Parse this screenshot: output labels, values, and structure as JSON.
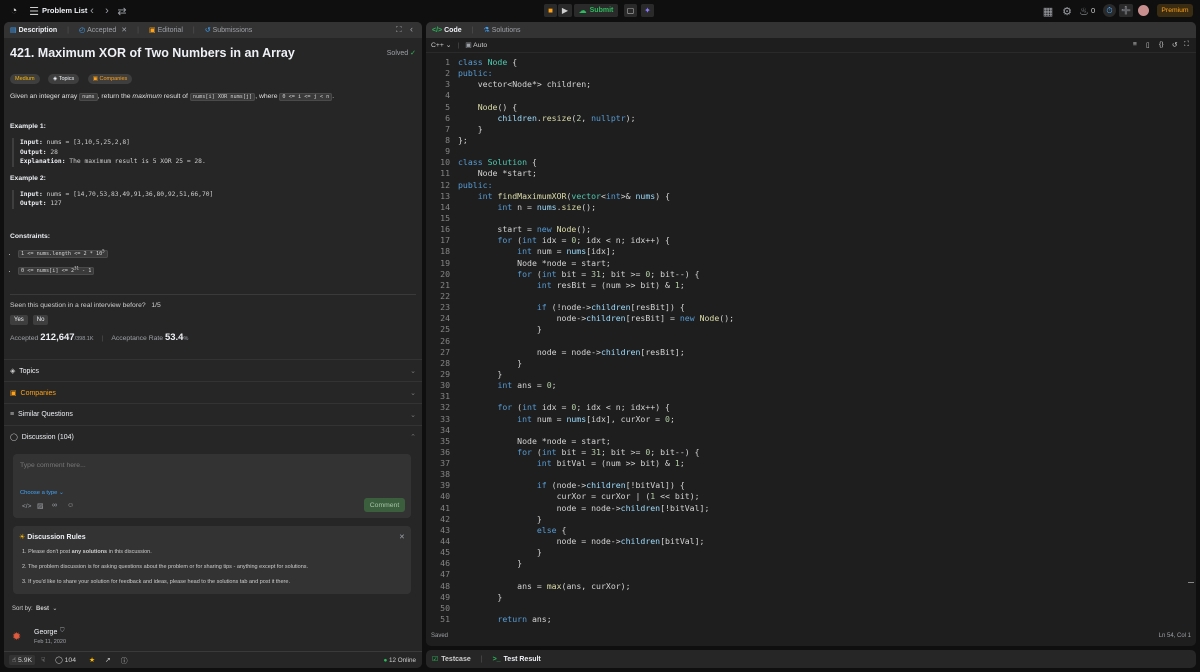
{
  "topbar": {
    "problem_list": "Problem List",
    "submit": "Submit",
    "streak": "0",
    "premium": "Premium"
  },
  "left_tabs": [
    {
      "label": "Description"
    },
    {
      "label": "Accepted"
    },
    {
      "label": "Editorial"
    },
    {
      "label": "Submissions"
    }
  ],
  "problem": {
    "title": "421. Maximum XOR of Two Numbers in an Array",
    "status": "Solved",
    "tags": [
      "Medium",
      "Topics",
      "Companies"
    ],
    "desc": [
      "Given an integer array ",
      "nums",
      ", return the ",
      "maximum",
      " result of ",
      "nums[i] XOR nums[j]",
      ", where ",
      "0 <= i <= j < n",
      "."
    ],
    "examples": [
      {
        "heading": "Example 1:",
        "lines": [
          [
            "Input:",
            " nums = [3,10,5,25,2,8]"
          ],
          [
            "Output:",
            " 28"
          ],
          [
            "Explanation:",
            " The maximum result is 5 XOR 25 = 28."
          ]
        ]
      },
      {
        "heading": "Example 2:",
        "lines": [
          [
            "Input:",
            " nums = [14,70,53,83,49,91,36,80,92,51,66,70]"
          ],
          [
            "Output:",
            " 127"
          ]
        ]
      }
    ],
    "constraints_title": "Constraints:",
    "constraints": [
      {
        "base": "1 <= nums.length <= 2 * 10",
        "sup": "5"
      },
      {
        "base": "0 <= nums[i] <= 2",
        "sup": "31",
        "tail": " - 1"
      }
    ]
  },
  "interview": {
    "question": "Seen this question in a real interview before?",
    "count": "1/5",
    "yes": "Yes",
    "no": "No"
  },
  "stats": {
    "accepted_label": "Accepted",
    "accepted_value": "212,647",
    "accepted_total": "/398.1K",
    "rate_label": "Acceptance Rate",
    "rate_value": "53.4",
    "rate_unit": "%"
  },
  "sections": [
    "Topics",
    "Companies",
    "Similar Questions",
    "Discussion (104)"
  ],
  "comment": {
    "placeholder": "Type comment here...",
    "choose": "Choose a type",
    "button": "Comment"
  },
  "rules": {
    "title": "Discussion Rules",
    "items": [
      {
        "pre": "1. Please don't post ",
        "bold": "any solutions",
        "post": " in this discussion."
      },
      {
        "pre": "2. The problem discussion is for asking questions about the problem or for sharing tips - anything except for solutions.",
        "bold": "",
        "post": ""
      },
      {
        "pre": "3. If you'd like to share your solution for feedback and ideas, please head to the solutions tab and post it there.",
        "bold": "",
        "post": ""
      }
    ]
  },
  "sort": {
    "label": "Sort by:",
    "value": "Best"
  },
  "post": {
    "user": "George",
    "date": "Feb 11, 2020"
  },
  "footer": {
    "likes": "5.9K",
    "comments": "104",
    "online": "12 Online"
  },
  "right_tabs": [
    {
      "label": "Code"
    },
    {
      "label": "Solutions"
    }
  ],
  "editor": {
    "lang": "C++",
    "mode": "Auto",
    "saved": "Saved",
    "pos": "Ln 54, Col 1"
  },
  "bottom_tabs": [
    {
      "label": "Testcase"
    },
    {
      "label": "Test Result"
    }
  ],
  "colors": {
    "accent": "#ffa116",
    "green": "#2cbb5d",
    "medium": "#ffb800",
    "link": "#3ea6ff"
  },
  "code_lines": [
    [
      [
        "class ",
        "kw"
      ],
      [
        "Node",
        "ty"
      ],
      [
        " {",
        "tx"
      ]
    ],
    [
      [
        "public:",
        "kw"
      ]
    ],
    [
      [
        "    vector<Node*> children;",
        "tx"
      ]
    ],
    [
      [
        "",
        "tx"
      ]
    ],
    [
      [
        "    ",
        "tx"
      ],
      [
        "Node",
        "fn"
      ],
      [
        "() {",
        "tx"
      ]
    ],
    [
      [
        "        ",
        "tx"
      ],
      [
        "children",
        "vr"
      ],
      [
        ".",
        "tx"
      ],
      [
        "resize",
        "fn"
      ],
      [
        "(",
        "tx"
      ],
      [
        "2",
        "nu"
      ],
      [
        ", ",
        "tx"
      ],
      [
        "nullptr",
        "kw"
      ],
      [
        ");",
        "tx"
      ]
    ],
    [
      [
        "    }",
        "tx"
      ]
    ],
    [
      [
        "};",
        "tx"
      ]
    ],
    [
      [
        "",
        "tx"
      ]
    ],
    [
      [
        "class ",
        "kw"
      ],
      [
        "Solution",
        "ty"
      ],
      [
        " {",
        "tx"
      ]
    ],
    [
      [
        "    Node *start;",
        "tx"
      ]
    ],
    [
      [
        "public:",
        "kw"
      ]
    ],
    [
      [
        "    ",
        "tx"
      ],
      [
        "int ",
        "kw"
      ],
      [
        "findMaximumXOR",
        "fn"
      ],
      [
        "(",
        "tx"
      ],
      [
        "vector",
        "ty"
      ],
      [
        "<",
        "tx"
      ],
      [
        "int",
        "kw"
      ],
      [
        ">& ",
        "tx"
      ],
      [
        "nums",
        "vr"
      ],
      [
        ") {",
        "tx"
      ]
    ],
    [
      [
        "        ",
        "tx"
      ],
      [
        "int ",
        "kw"
      ],
      [
        "n = ",
        "tx"
      ],
      [
        "nums",
        "vr"
      ],
      [
        ".",
        "tx"
      ],
      [
        "size",
        "fn"
      ],
      [
        "();",
        "tx"
      ]
    ],
    [
      [
        "",
        "tx"
      ]
    ],
    [
      [
        "        start = ",
        "tx"
      ],
      [
        "new ",
        "kw"
      ],
      [
        "Node",
        "fn"
      ],
      [
        "();",
        "tx"
      ]
    ],
    [
      [
        "        ",
        "tx"
      ],
      [
        "for ",
        "kw"
      ],
      [
        "(",
        "tx"
      ],
      [
        "int ",
        "kw"
      ],
      [
        "idx = ",
        "tx"
      ],
      [
        "0",
        "nu"
      ],
      [
        "; idx < n; idx++) {",
        "tx"
      ]
    ],
    [
      [
        "            ",
        "tx"
      ],
      [
        "int ",
        "kw"
      ],
      [
        "num = ",
        "tx"
      ],
      [
        "nums",
        "vr"
      ],
      [
        "[idx];",
        "tx"
      ]
    ],
    [
      [
        "            Node *node = start;",
        "tx"
      ]
    ],
    [
      [
        "            ",
        "tx"
      ],
      [
        "for ",
        "kw"
      ],
      [
        "(",
        "tx"
      ],
      [
        "int ",
        "kw"
      ],
      [
        "bit = ",
        "tx"
      ],
      [
        "31",
        "nu"
      ],
      [
        "; bit >= ",
        "tx"
      ],
      [
        "0",
        "nu"
      ],
      [
        "; bit--) {",
        "tx"
      ]
    ],
    [
      [
        "                ",
        "tx"
      ],
      [
        "int ",
        "kw"
      ],
      [
        "resBit = (num >> bit) & ",
        "tx"
      ],
      [
        "1",
        "nu"
      ],
      [
        ";",
        "tx"
      ]
    ],
    [
      [
        "",
        "tx"
      ]
    ],
    [
      [
        "                ",
        "tx"
      ],
      [
        "if ",
        "kw"
      ],
      [
        "(!node->",
        "tx"
      ],
      [
        "children",
        "vr"
      ],
      [
        "[resBit]) {",
        "tx"
      ]
    ],
    [
      [
        "                    node->",
        "tx"
      ],
      [
        "children",
        "vr"
      ],
      [
        "[resBit] = ",
        "tx"
      ],
      [
        "new ",
        "kw"
      ],
      [
        "Node",
        "fn"
      ],
      [
        "();",
        "tx"
      ]
    ],
    [
      [
        "                }",
        "tx"
      ]
    ],
    [
      [
        "",
        "tx"
      ]
    ],
    [
      [
        "                node = node->",
        "tx"
      ],
      [
        "children",
        "vr"
      ],
      [
        "[resBit];",
        "tx"
      ]
    ],
    [
      [
        "            }",
        "tx"
      ]
    ],
    [
      [
        "        }",
        "tx"
      ]
    ],
    [
      [
        "        ",
        "tx"
      ],
      [
        "int ",
        "kw"
      ],
      [
        "ans = ",
        "tx"
      ],
      [
        "0",
        "nu"
      ],
      [
        ";",
        "tx"
      ]
    ],
    [
      [
        "",
        "tx"
      ]
    ],
    [
      [
        "        ",
        "tx"
      ],
      [
        "for ",
        "kw"
      ],
      [
        "(",
        "tx"
      ],
      [
        "int ",
        "kw"
      ],
      [
        "idx = ",
        "tx"
      ],
      [
        "0",
        "nu"
      ],
      [
        "; idx < n; idx++) {",
        "tx"
      ]
    ],
    [
      [
        "            ",
        "tx"
      ],
      [
        "int ",
        "kw"
      ],
      [
        "num = ",
        "tx"
      ],
      [
        "nums",
        "vr"
      ],
      [
        "[idx], curXor = ",
        "tx"
      ],
      [
        "0",
        "nu"
      ],
      [
        ";",
        "tx"
      ]
    ],
    [
      [
        "",
        "tx"
      ]
    ],
    [
      [
        "            Node *node = start;",
        "tx"
      ]
    ],
    [
      [
        "            ",
        "tx"
      ],
      [
        "for ",
        "kw"
      ],
      [
        "(",
        "tx"
      ],
      [
        "int ",
        "kw"
      ],
      [
        "bit = ",
        "tx"
      ],
      [
        "31",
        "nu"
      ],
      [
        "; bit >= ",
        "tx"
      ],
      [
        "0",
        "nu"
      ],
      [
        "; bit--) {",
        "tx"
      ]
    ],
    [
      [
        "                ",
        "tx"
      ],
      [
        "int ",
        "kw"
      ],
      [
        "bitVal = (num >> bit) & ",
        "tx"
      ],
      [
        "1",
        "nu"
      ],
      [
        ";",
        "tx"
      ]
    ],
    [
      [
        "",
        "tx"
      ]
    ],
    [
      [
        "                ",
        "tx"
      ],
      [
        "if ",
        "kw"
      ],
      [
        "(node->",
        "tx"
      ],
      [
        "children",
        "vr"
      ],
      [
        "[!bitVal]) {",
        "tx"
      ]
    ],
    [
      [
        "                    curXor = curXor | (",
        "tx"
      ],
      [
        "1",
        "nu"
      ],
      [
        " << bit);",
        "tx"
      ]
    ],
    [
      [
        "                    node = node->",
        "tx"
      ],
      [
        "children",
        "vr"
      ],
      [
        "[!bitVal];",
        "tx"
      ]
    ],
    [
      [
        "                }",
        "tx"
      ]
    ],
    [
      [
        "                ",
        "tx"
      ],
      [
        "else ",
        "kw"
      ],
      [
        "{",
        "tx"
      ]
    ],
    [
      [
        "                    node = node->",
        "tx"
      ],
      [
        "children",
        "vr"
      ],
      [
        "[bitVal];",
        "tx"
      ]
    ],
    [
      [
        "                }",
        "tx"
      ]
    ],
    [
      [
        "            }",
        "tx"
      ]
    ],
    [
      [
        "",
        "tx"
      ]
    ],
    [
      [
        "            ans = ",
        "tx"
      ],
      [
        "max",
        "fn"
      ],
      [
        "(ans, curXor);",
        "tx"
      ]
    ],
    [
      [
        "        }",
        "tx"
      ]
    ],
    [
      [
        "",
        "tx"
      ]
    ],
    [
      [
        "        ",
        "tx"
      ],
      [
        "return ",
        "kw"
      ],
      [
        "ans;",
        "tx"
      ]
    ]
  ]
}
